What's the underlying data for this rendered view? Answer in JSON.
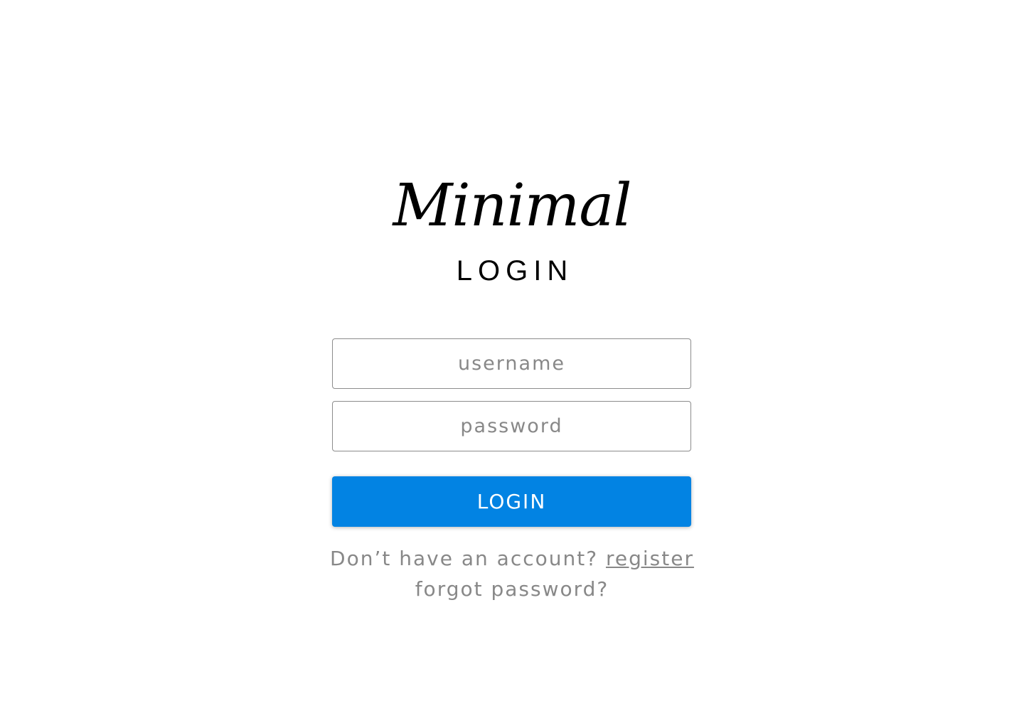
{
  "brand": {
    "logo_text": "Minimal"
  },
  "page": {
    "heading": "LOGIN"
  },
  "form": {
    "username": {
      "value": "",
      "placeholder": "username"
    },
    "password": {
      "value": "",
      "placeholder": "password"
    },
    "submit_label": "LOGIN"
  },
  "footer": {
    "no_account_text": "Don’t have an account?",
    "register_label": "register",
    "forgot_label": "forgot password?"
  },
  "colors": {
    "background": "#ffffff",
    "primary_button": "#0283e3",
    "button_text": "#ffffff",
    "muted_text": "#888888",
    "heading_text": "#000000",
    "field_border": "#8c8c8c"
  }
}
